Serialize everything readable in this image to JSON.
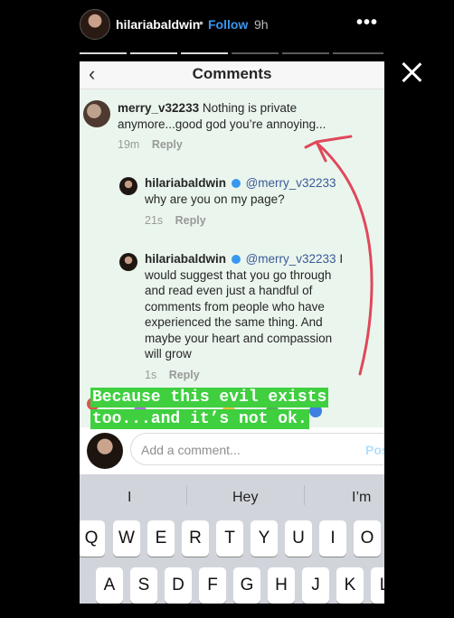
{
  "story": {
    "username": "hilariabaldwin",
    "separator": "•",
    "follow_label": "Follow",
    "time_ago": "9h",
    "more_label": "•••"
  },
  "screenshot": {
    "title": "Comments",
    "comments": [
      {
        "username": "merry_v32233",
        "text_line1": "Nothing is private",
        "text_line2": "anymore...good god you’re annoying...",
        "time": "19m",
        "reply": "Reply"
      },
      {
        "username": "hilariabaldwin",
        "mention": "@merry_v32233",
        "text_line1": "why are you on my page?",
        "time": "21s",
        "reply": "Reply"
      },
      {
        "username": "hilariabaldwin",
        "mention": "@merry_v32233",
        "text_first": "I",
        "text_lines": [
          "would suggest that you go through",
          "and read even just a handful of",
          "comments from people who have",
          "experienced the same thing. And",
          "maybe your heart and compassion",
          "will grow"
        ],
        "time": "1s",
        "reply": "Reply"
      }
    ],
    "input_placeholder": "Add a comment...",
    "post_label": "Pos",
    "keyboard": {
      "suggestions": [
        "I",
        "Hey",
        "I’m"
      ],
      "row1": [
        "Q",
        "W",
        "E",
        "R",
        "T",
        "Y",
        "U",
        "I",
        "O"
      ],
      "row2": [
        "A",
        "S",
        "D",
        "F",
        "G",
        "H",
        "J",
        "K",
        "L"
      ]
    }
  },
  "overlay_text": {
    "line1": "Because this evil exists",
    "line2": "too...and it’s not ok."
  },
  "colors": {
    "follow": "#3897f0",
    "overlay_bg": "#3fcf3f",
    "arrow": "#e0485a",
    "verified": "#3897f0"
  }
}
